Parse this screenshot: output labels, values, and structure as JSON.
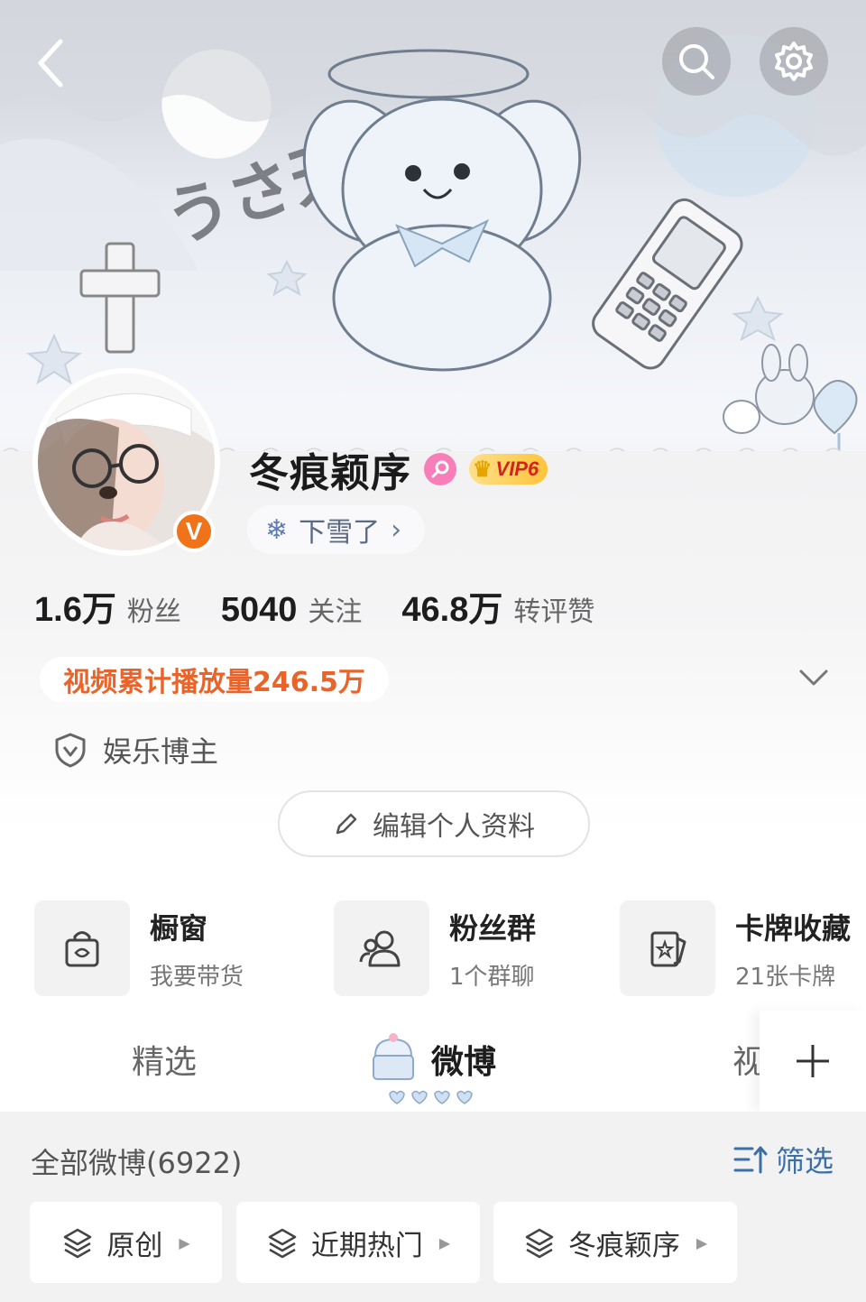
{
  "header": {
    "back_icon": "chevron-left-icon",
    "search_icon": "search-icon",
    "settings_icon": "gear-icon"
  },
  "banner": {
    "art_text": "うさ天使"
  },
  "profile": {
    "name": "冬痕颖序",
    "gender_icon": "female-icon",
    "vip_label": "VIP6",
    "verified_label": "V",
    "status": {
      "text": "下雪了",
      "icon": "snowflake-icon",
      "arrow": "›"
    },
    "stats": [
      {
        "value": "1.6万",
        "label": "粉丝"
      },
      {
        "value": "5040",
        "label": "关注"
      },
      {
        "value": "46.8万",
        "label": "转评赞"
      }
    ],
    "play_count": "视频累计播放量246.5万",
    "tag": "娱乐博主",
    "edit_button": "编辑个人资料"
  },
  "features": [
    {
      "title": "橱窗",
      "sub": "我要带货",
      "icon": "shopping-bag-icon"
    },
    {
      "title": "粉丝群",
      "sub": "1个群聊",
      "icon": "group-icon"
    },
    {
      "title": "卡牌收藏",
      "sub": "21张卡牌",
      "icon": "card-icon"
    }
  ],
  "tabs": [
    {
      "label": "精选"
    },
    {
      "label": "微博",
      "active": true
    },
    {
      "label": "视"
    }
  ],
  "feed": {
    "title": "全部微博(6922)",
    "filter_label": "筛选",
    "chips": [
      {
        "label": "原创"
      },
      {
        "label": "近期热门"
      },
      {
        "label": "冬痕颖序"
      }
    ]
  },
  "colors": {
    "accent_orange": "#e8642b",
    "link_blue": "#3b6fa6",
    "vip_gold": "#ffc43a",
    "verified_orange": "#f0731a",
    "female_pink": "#f77eb9"
  }
}
